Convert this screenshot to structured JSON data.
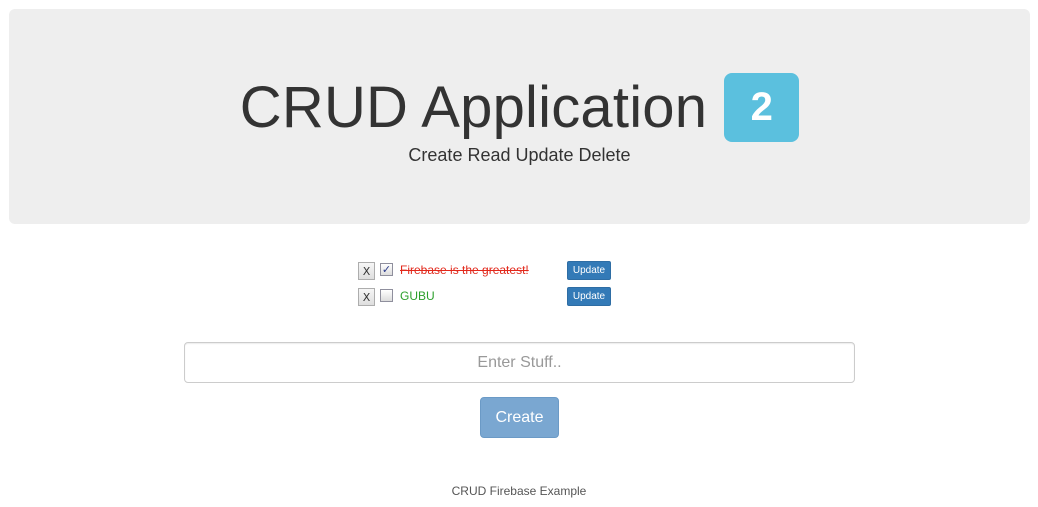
{
  "header": {
    "title": "CRUD Application",
    "count_badge": "2",
    "subtitle": "Create Read Update Delete",
    "badge_color": "#5bc0de"
  },
  "todos": [
    {
      "delete_label": "X",
      "checked": true,
      "check_mark": "✓",
      "text": "Firebase is the greatest!",
      "text_color": "#e2281b",
      "update_label": "Update"
    },
    {
      "delete_label": "X",
      "checked": false,
      "check_mark": "",
      "text": "GUBU",
      "text_color": "#2ca02c",
      "update_label": "Update"
    }
  ],
  "form": {
    "input_value": "",
    "input_placeholder": "Enter Stuff..",
    "create_label": "Create",
    "create_color": "#7aa7d1"
  },
  "footer": {
    "text": "CRUD Firebase Example"
  },
  "colors": {
    "primary": "#337ab7",
    "jumbotron_bg": "#eeeeee"
  }
}
